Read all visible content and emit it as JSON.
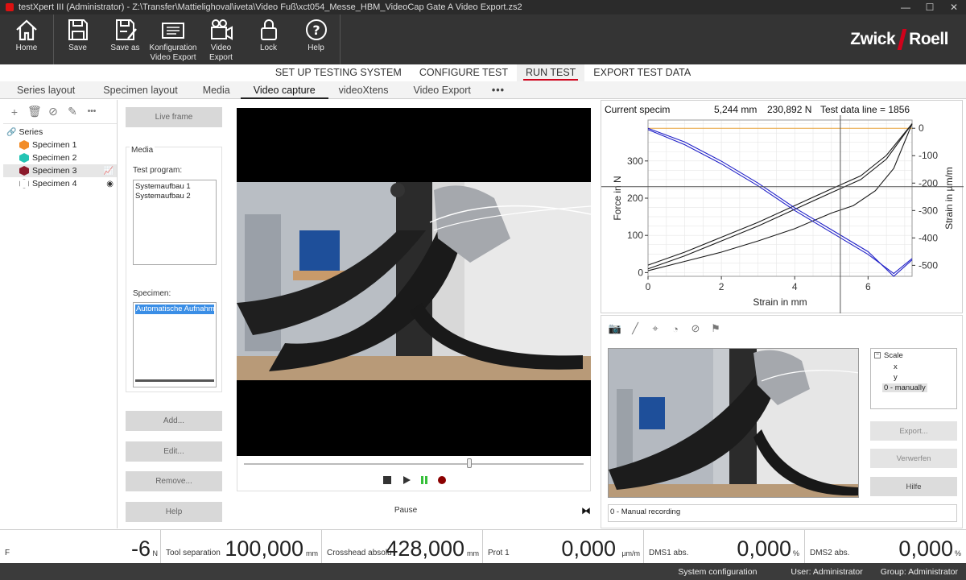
{
  "window": {
    "title": "testXpert III (Administrator) - Z:\\Transfer\\Mattielighoval\\iveta\\Video Fuß\\xct054_Messe_HBM_VideoCap Gate A Video Export.zs2",
    "min": "—",
    "max": "☐",
    "close": "✕"
  },
  "ribbon": {
    "home": "Home",
    "save": "Save",
    "save_as": "Save as",
    "config_video_export": "Konfiguration Video Export",
    "video_export": "Video Export",
    "lock": "Lock",
    "help": "Help",
    "logo_left": "Zwick",
    "logo_right": "Roell"
  },
  "workflow_tabs": [
    "SET UP TESTING SYSTEM",
    "CONFIGURE TEST",
    "RUN TEST",
    "EXPORT TEST DATA"
  ],
  "sub_tabs": [
    "Series layout",
    "Specimen layout",
    "Media",
    "Video capture",
    "videoXtens",
    "Video Export",
    "•••"
  ],
  "tree": {
    "tools": [
      "+",
      "🗑",
      "⊘",
      "✎",
      "•••"
    ],
    "root": "Series",
    "items": [
      {
        "label": "Specimen 1",
        "color": "#f28c28"
      },
      {
        "label": "Specimen 2",
        "color": "#23c4b4"
      },
      {
        "label": "Specimen 3",
        "color": "#8b1a2b"
      },
      {
        "label": "Specimen 4",
        "color": "#ffffff"
      }
    ]
  },
  "media": {
    "live_frame": "Live frame",
    "title": "Media",
    "test_program_label": "Test program:",
    "test_program_items": [
      "Systemaufbau 1",
      "Systemaufbau 2"
    ],
    "specimen_label": "Specimen:",
    "specimen_item": "Automatische Aufnahme",
    "add": "Add...",
    "edit": "Edit...",
    "remove": "Remove...",
    "help": "Help"
  },
  "video": {
    "status": "Pause",
    "slider_position": 0.66
  },
  "chart_data": {
    "type": "line",
    "header": {
      "current": "Current specim",
      "value1": "5,244 mm",
      "value2": "230,892 N",
      "line": "Test data line = 1856"
    },
    "xlabel": "Strain in mm",
    "ylabel": "Force in N",
    "y2label": "Strain in µm/m",
    "xlim": [
      0,
      7.2
    ],
    "ylim": [
      -10,
      410
    ],
    "y2lim": [
      -540,
      30
    ],
    "xticks": [
      "0",
      "2",
      "4",
      "6"
    ],
    "yticks": [
      "0",
      "100",
      "200",
      "300"
    ],
    "y2ticks": [
      "0",
      "-100",
      "-200",
      "-300",
      "-400",
      "-500"
    ],
    "cursor_x": 5.244,
    "series": [
      {
        "color": "#1a1a1a",
        "axis": "left",
        "x": [
          0,
          1,
          2,
          3,
          4,
          5,
          5.6,
          6.2,
          6.7,
          7.2
        ],
        "y": [
          5,
          30,
          55,
          85,
          118,
          160,
          180,
          220,
          280,
          400
        ]
      },
      {
        "color": "#1a1a1a",
        "axis": "left",
        "x": [
          0,
          1,
          2,
          3,
          4,
          5,
          5.8,
          6.5,
          7.2
        ],
        "y": [
          10,
          45,
          85,
          125,
          170,
          215,
          250,
          305,
          400
        ]
      },
      {
        "color": "#1a1a1a",
        "axis": "left",
        "x": [
          0,
          1,
          2,
          3,
          4,
          5,
          5.8,
          6.5,
          7.2
        ],
        "y": [
          20,
          55,
          95,
          135,
          180,
          225,
          260,
          315,
          400
        ]
      },
      {
        "color": "#2020c8",
        "axis": "right",
        "x": [
          0,
          1,
          2,
          3,
          4,
          5,
          6,
          6.7,
          7.2
        ],
        "y": [
          0,
          -50,
          -120,
          -200,
          -290,
          -370,
          -450,
          -540,
          -480
        ]
      },
      {
        "color": "#2020c8",
        "axis": "right",
        "x": [
          0,
          1,
          2,
          3,
          4,
          5,
          6,
          6.7,
          7.2
        ],
        "y": [
          -5,
          -60,
          -130,
          -210,
          -300,
          -380,
          -460,
          -530,
          -475
        ]
      }
    ]
  },
  "lower": {
    "tools": [
      "📷",
      "╱",
      "⌖",
      "◔",
      "⊘",
      "⚑"
    ],
    "scale_root": "Scale",
    "scale_x": "x",
    "scale_y": "y",
    "scale_manual": "0 - manually",
    "export": "Export...",
    "discard": "Verwerfen",
    "help": "Hilfe",
    "manual_recording": "0 - Manual recording"
  },
  "readouts": [
    {
      "name": "F",
      "value": "-6",
      "unit": "N"
    },
    {
      "name": "Tool separation",
      "value": "100,000",
      "unit": "mm"
    },
    {
      "name": "Crosshead absolu",
      "value": "428,000",
      "unit": "mm"
    },
    {
      "name": "Prot 1",
      "value": "0,000",
      "unit": "µm/m"
    },
    {
      "name": "DMS1 abs.",
      "value": "0,000",
      "unit": "%"
    },
    {
      "name": "DMS2 abs.",
      "value": "0,000",
      "unit": "%"
    }
  ],
  "status": {
    "system_config": "System configuration",
    "user": "User: Administrator",
    "group": "Group: Administrator"
  }
}
